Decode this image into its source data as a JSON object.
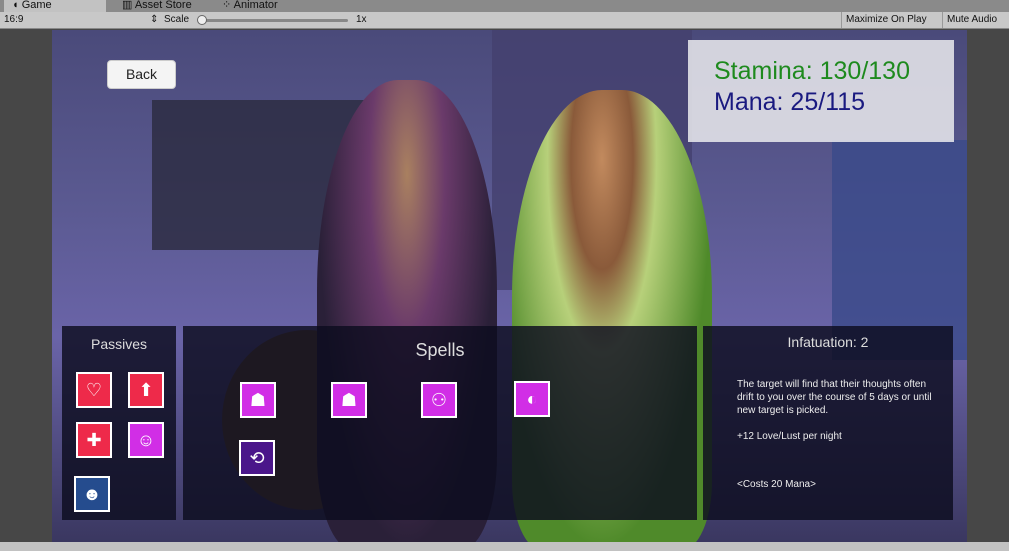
{
  "editor": {
    "tabs": [
      "Game",
      "Asset Store",
      "Animator"
    ],
    "aspect": "16:9",
    "scale_label": "Scale",
    "scale_value": "1x",
    "maximize": "Maximize On Play",
    "mute": "Mute Audio"
  },
  "game": {
    "back_label": "Back",
    "stamina": "Stamina: 130/130",
    "mana": "Mana: 25/115",
    "passives_title": "Passives",
    "spells_title": "Spells",
    "passives": [
      {
        "icon": "heart-devil-icon",
        "color": "#ee2a4a"
      },
      {
        "icon": "arrow-up-icon",
        "color": "#ee2a4a"
      },
      {
        "icon": "health-cross-icon",
        "color": "#ee2a4a"
      },
      {
        "icon": "wink-face-icon",
        "color": "#d12ee6"
      },
      {
        "icon": "cheer-person-icon",
        "color": "#254c8e"
      }
    ],
    "spells": [
      {
        "icon": "infatuation-person-icon",
        "color": "#d12ee6"
      },
      {
        "icon": "love-person-icon",
        "color": "#d12ee6"
      },
      {
        "icon": "couple-icon",
        "color": "#d12ee6"
      },
      {
        "icon": "mirror-portrait-icon",
        "color": "#d12ee6"
      },
      {
        "icon": "swap-people-icon",
        "color": "#4a168a"
      }
    ],
    "info": {
      "title": "Infatuation:  2",
      "description": "The target will find that their thoughts often drift to you over the course of 5 days or until new target is picked.",
      "effect": "+12  Love/Lust per night",
      "cost": "<Costs 20 Mana>"
    }
  },
  "colors": {
    "stamina": "#1e8a1e",
    "mana": "#1a1a80"
  }
}
